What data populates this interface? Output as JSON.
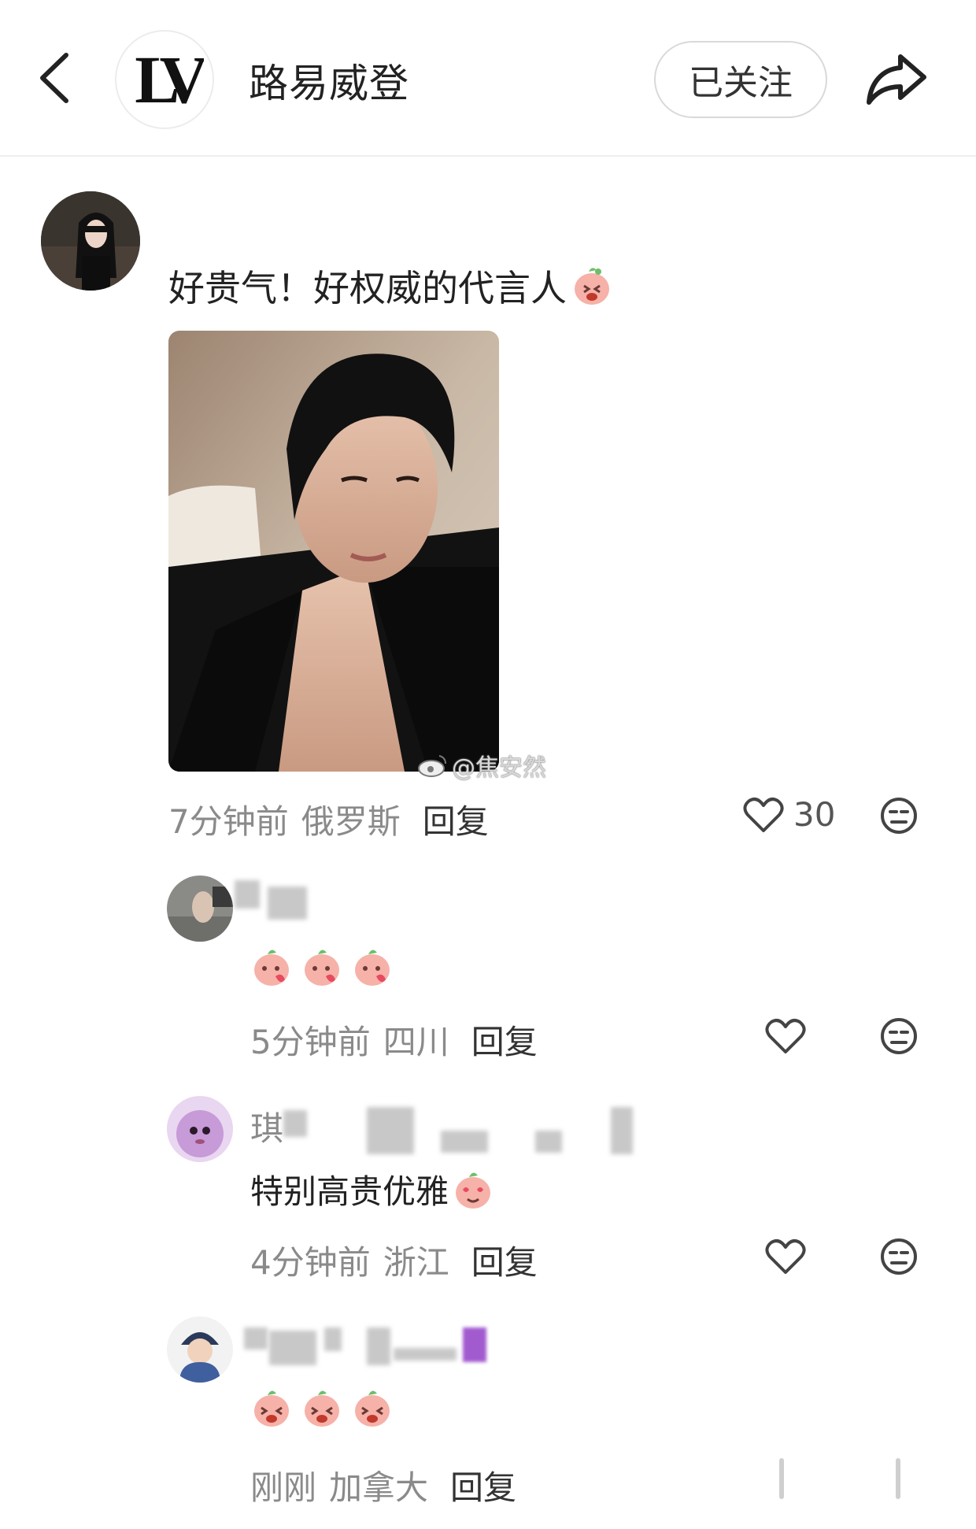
{
  "header": {
    "back_icon": "chevron-left-icon",
    "brand_logo_text": "LV",
    "title": "路易威登",
    "follow_label": "已关注",
    "share_icon": "share-arrow-icon"
  },
  "main_comment": {
    "text": "好贵气！好权威的代言人",
    "watermark": "@焦安然",
    "time": "7分钟前",
    "location": "俄罗斯",
    "reply_label": "回复",
    "like_count": "30"
  },
  "replies": [
    {
      "username": "",
      "text": "",
      "emoji_count": 3,
      "time": "5分钟前",
      "location": "四川",
      "reply_label": "回复"
    },
    {
      "username": "琪",
      "text": "特别高贵优雅",
      "time": "4分钟前",
      "location": "浙江",
      "reply_label": "回复"
    },
    {
      "username": "",
      "text": "",
      "emoji_count": 3,
      "time": "刚刚",
      "location": "加拿大",
      "reply_label": "回复"
    }
  ],
  "colors": {
    "meta_gray": "#8a8a8a",
    "emoji_peach": "#f4a7a0",
    "heart_red": "#e84a5f"
  }
}
